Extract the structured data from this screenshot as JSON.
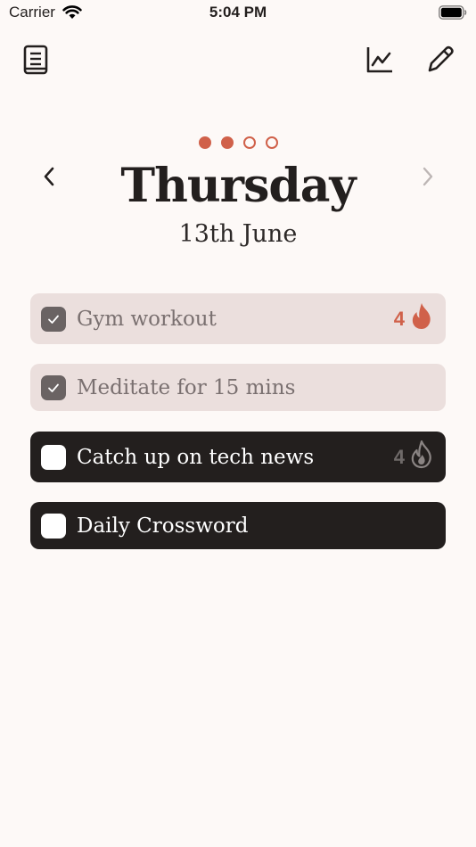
{
  "status_bar": {
    "carrier": "Carrier",
    "time": "5:04 PM"
  },
  "toolbar": {
    "journal_icon": "book-icon",
    "stats_icon": "chart-line-icon",
    "edit_icon": "pencil-icon"
  },
  "pager": {
    "total": 4,
    "filled": 2,
    "accent": "#D0614A"
  },
  "day": {
    "title": "Thursday",
    "date": "13th June"
  },
  "habits": [
    {
      "label": "Gym workout",
      "done": true,
      "streak": "4",
      "streak_color": "#D0614A"
    },
    {
      "label": "Meditate for 15 mins",
      "done": true,
      "streak": ""
    },
    {
      "label": "Catch up on tech news",
      "done": false,
      "streak": "4",
      "streak_color": "#6F6A69"
    },
    {
      "label": "Daily Crossword",
      "done": false,
      "streak": ""
    }
  ],
  "colors": {
    "background": "#FDF9F7",
    "done_row": "#EBDFDD",
    "todo_row": "#231F1E",
    "accent": "#D0614A"
  }
}
